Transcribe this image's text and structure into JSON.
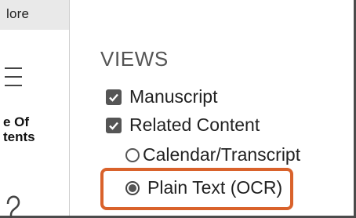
{
  "sidebar": {
    "more_label": "lore",
    "toc_icon": "hamburger-menu-icon",
    "toc_label_line1": "e Of",
    "toc_label_line2": "tents",
    "bottom_icon": "partial-glyph-icon"
  },
  "views": {
    "title": "VIEWS",
    "options": [
      {
        "label": "Manuscript",
        "type": "checkbox",
        "checked": true
      },
      {
        "label": "Related Content",
        "type": "checkbox",
        "checked": true
      },
      {
        "label": "Calendar/Transcript",
        "type": "radio",
        "checked": false
      },
      {
        "label": "Plain Text (OCR)",
        "type": "radio",
        "checked": true
      }
    ]
  },
  "colors": {
    "highlight": "#d9622b",
    "control": "#555555"
  }
}
